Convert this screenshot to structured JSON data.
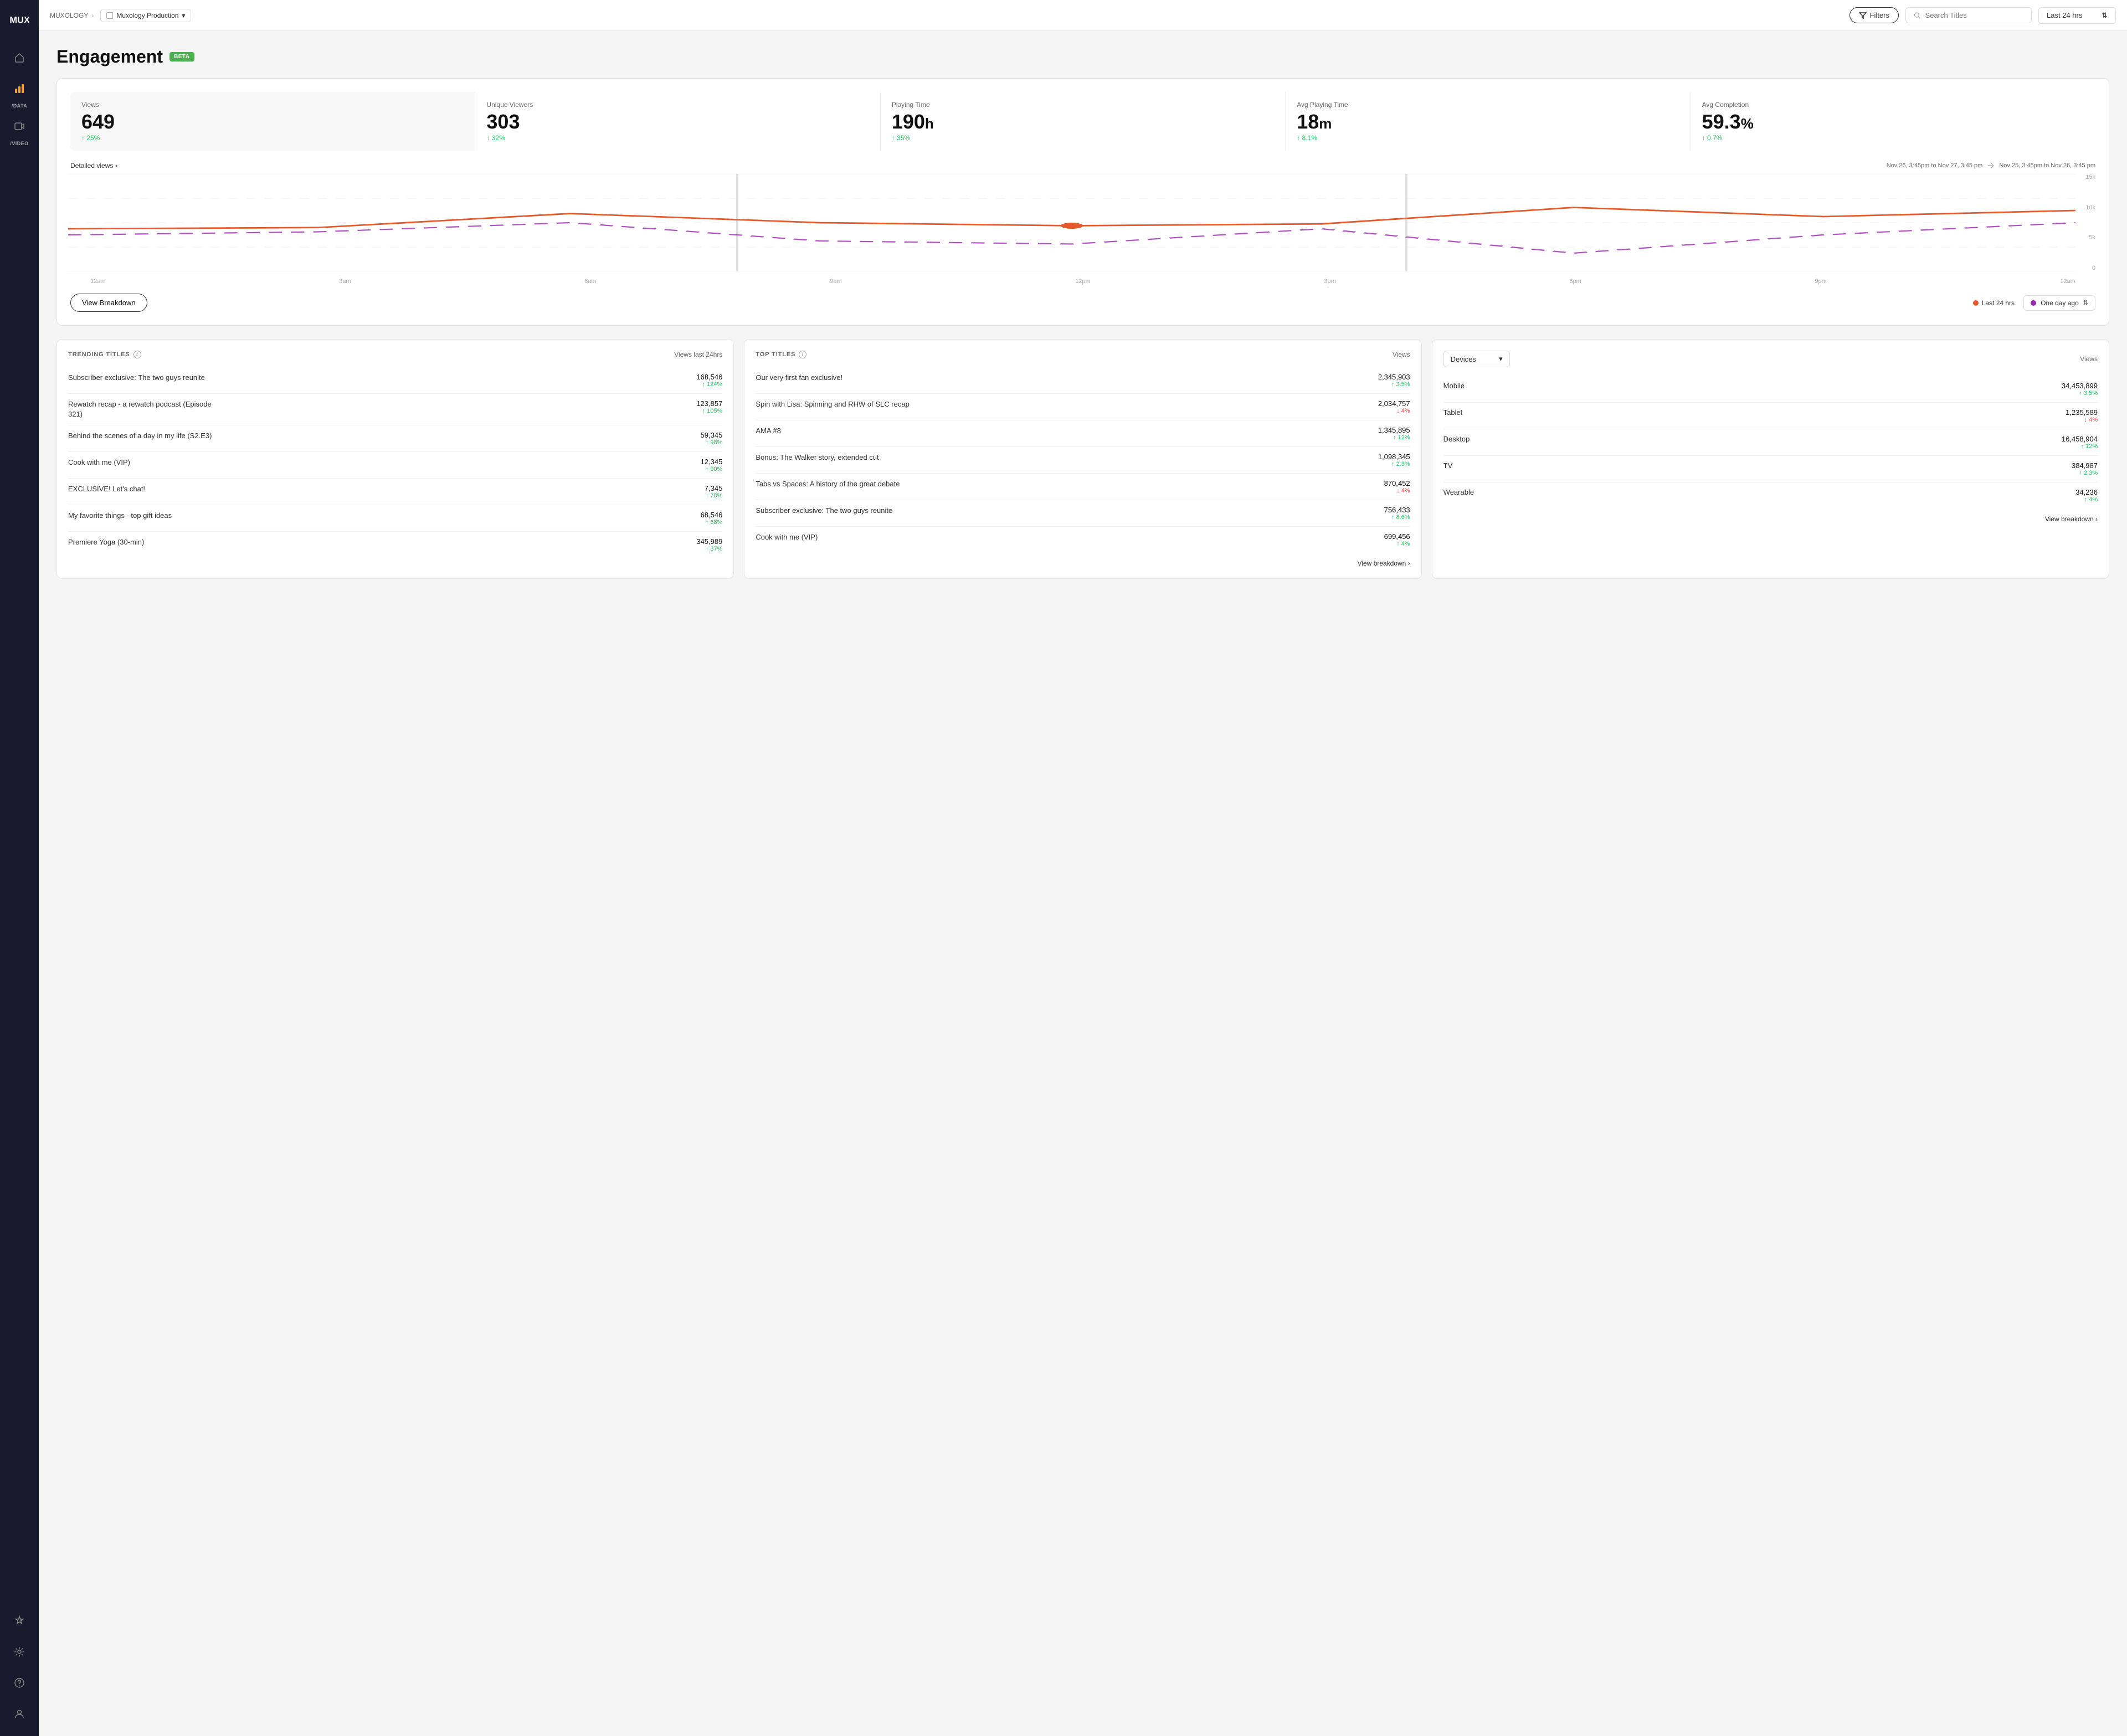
{
  "sidebar": {
    "logo": "MUX",
    "items": [
      {
        "id": "home",
        "icon": "⌂",
        "label": ""
      },
      {
        "id": "data",
        "icon": "📊",
        "label": "/DATA"
      },
      {
        "id": "video",
        "icon": "▶",
        "label": "/VIDEO"
      },
      {
        "id": "alerts",
        "icon": "⚡",
        "label": ""
      },
      {
        "id": "settings",
        "icon": "⚙",
        "label": ""
      },
      {
        "id": "help",
        "icon": "?",
        "label": ""
      },
      {
        "id": "user",
        "icon": "👤",
        "label": ""
      }
    ]
  },
  "topbar": {
    "breadcrumb_root": "MUXOLOGY",
    "breadcrumb_separator": "›",
    "env_label": "Muxology Production",
    "filter_btn": "Filters",
    "search_placeholder": "Search Titles",
    "time_range": "Last 24 hrs"
  },
  "page": {
    "title": "Engagement",
    "badge": "BETA"
  },
  "stats": [
    {
      "label": "Views",
      "value": "649",
      "unit": "",
      "change": "25%",
      "direction": "up",
      "highlighted": true
    },
    {
      "label": "Unique Viewers",
      "value": "303",
      "unit": "",
      "change": "32%",
      "direction": "up"
    },
    {
      "label": "Playing Time",
      "value": "190",
      "unit": "h",
      "change": "35%",
      "direction": "up"
    },
    {
      "label": "Avg Playing Time",
      "value": "18",
      "unit": "m",
      "change": "8.1%",
      "direction": "up"
    },
    {
      "label": "Avg Completion",
      "value": "59.3",
      "unit": "%",
      "change": "0.7%",
      "direction": "up"
    }
  ],
  "chart": {
    "detailed_views_link": "Detailed views",
    "current_range": "Nov 26, 3:45pm to Nov 27, 3:45 pm",
    "previous_range": "Nov 25, 3:45pm to Nov 26, 3:45 pm",
    "y_labels": [
      "15k",
      "10k",
      "5k",
      "0"
    ],
    "x_labels": [
      "12am",
      "3am",
      "6am",
      "9am",
      "12pm",
      "3pm",
      "6pm",
      "9pm",
      "12am"
    ],
    "view_breakdown_btn": "View Breakdown",
    "legend_current": "Last 24 hrs",
    "legend_previous": "One day ago"
  },
  "trending": {
    "title": "TRENDING TITLES",
    "col_label": "Views last 24hrs",
    "items": [
      {
        "title": "Subscriber exclusive: The two guys reunite",
        "count": "168,546",
        "change": "124%",
        "direction": "up"
      },
      {
        "title": "Rewatch recap - a rewatch podcast (Episode 321)",
        "count": "123,857",
        "change": "105%",
        "direction": "up"
      },
      {
        "title": "Behind the scenes of a day in my life (S2.E3)",
        "count": "59,345",
        "change": "98%",
        "direction": "up"
      },
      {
        "title": "Cook with me (VIP)",
        "count": "12,345",
        "change": "90%",
        "direction": "up"
      },
      {
        "title": "EXCLUSIVE! Let's chat!",
        "count": "7,345",
        "change": "78%",
        "direction": "up"
      },
      {
        "title": "My favorite things - top gift ideas",
        "count": "68,546",
        "change": "68%",
        "direction": "up"
      },
      {
        "title": "Premiere Yoga (30-min)",
        "count": "345,989",
        "change": "37%",
        "direction": "up"
      }
    ]
  },
  "top_titles": {
    "title": "TOP TITLES",
    "col_label": "Views",
    "items": [
      {
        "title": "Our very first fan exclusive!",
        "count": "2,345,903",
        "change": "3.5%",
        "direction": "up"
      },
      {
        "title": "Spin with Lisa: Spinning and RHW of SLC recap",
        "count": "2,034,757",
        "change": "4%",
        "direction": "down"
      },
      {
        "title": "AMA #8",
        "count": "1,345,895",
        "change": "12%",
        "direction": "up"
      },
      {
        "title": "Bonus: The Walker story, extended cut",
        "count": "1,098,345",
        "change": "2.3%",
        "direction": "up"
      },
      {
        "title": "Tabs vs Spaces: A history of the great debate",
        "count": "870,452",
        "change": "4%",
        "direction": "down"
      },
      {
        "title": "Subscriber exclusive: The two guys reunite",
        "count": "756,433",
        "change": "8.6%",
        "direction": "up"
      },
      {
        "title": "Cook with me (VIP)",
        "count": "699,456",
        "change": "4%",
        "direction": "up"
      }
    ],
    "view_breakdown": "View breakdown ›"
  },
  "devices": {
    "selector_label": "Devices",
    "col_label": "Views",
    "items": [
      {
        "name": "Mobile",
        "count": "34,453,899",
        "change": "3.5%",
        "direction": "up"
      },
      {
        "name": "Tablet",
        "count": "1,235,589",
        "change": "4%",
        "direction": "down"
      },
      {
        "name": "Desktop",
        "count": "16,458,904",
        "change": "12%",
        "direction": "up"
      },
      {
        "name": "TV",
        "count": "384,987",
        "change": "2.3%",
        "direction": "up"
      },
      {
        "name": "Wearable",
        "count": "34,236",
        "change": "4%",
        "direction": "up"
      }
    ],
    "view_breakdown": "View breakdown ›"
  }
}
